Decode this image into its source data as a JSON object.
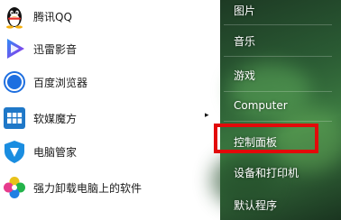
{
  "programs": [
    {
      "label": "腾讯QQ",
      "icon": "qq-penguin-icon"
    },
    {
      "label": "迅雷影音",
      "icon": "xunlei-play-icon"
    },
    {
      "label": "百度浏览器",
      "icon": "baidu-browser-icon"
    },
    {
      "label": "软媒魔方",
      "icon": "ruanmei-cube-icon"
    },
    {
      "label": "电脑管家",
      "icon": "pc-manager-shield-icon"
    },
    {
      "label": "强力卸载电脑上的软件",
      "icon": "uninstall-flower-icon"
    }
  ],
  "submenu_arrow": "▸",
  "right_menu": [
    {
      "label": "图片"
    },
    {
      "label": "音乐"
    },
    {
      "label": "游戏"
    },
    {
      "label": "Computer"
    },
    {
      "label": "控制面板"
    },
    {
      "label": "设备和打印机"
    },
    {
      "label": "默认程序"
    }
  ],
  "highlight_color": "#e20a0a"
}
